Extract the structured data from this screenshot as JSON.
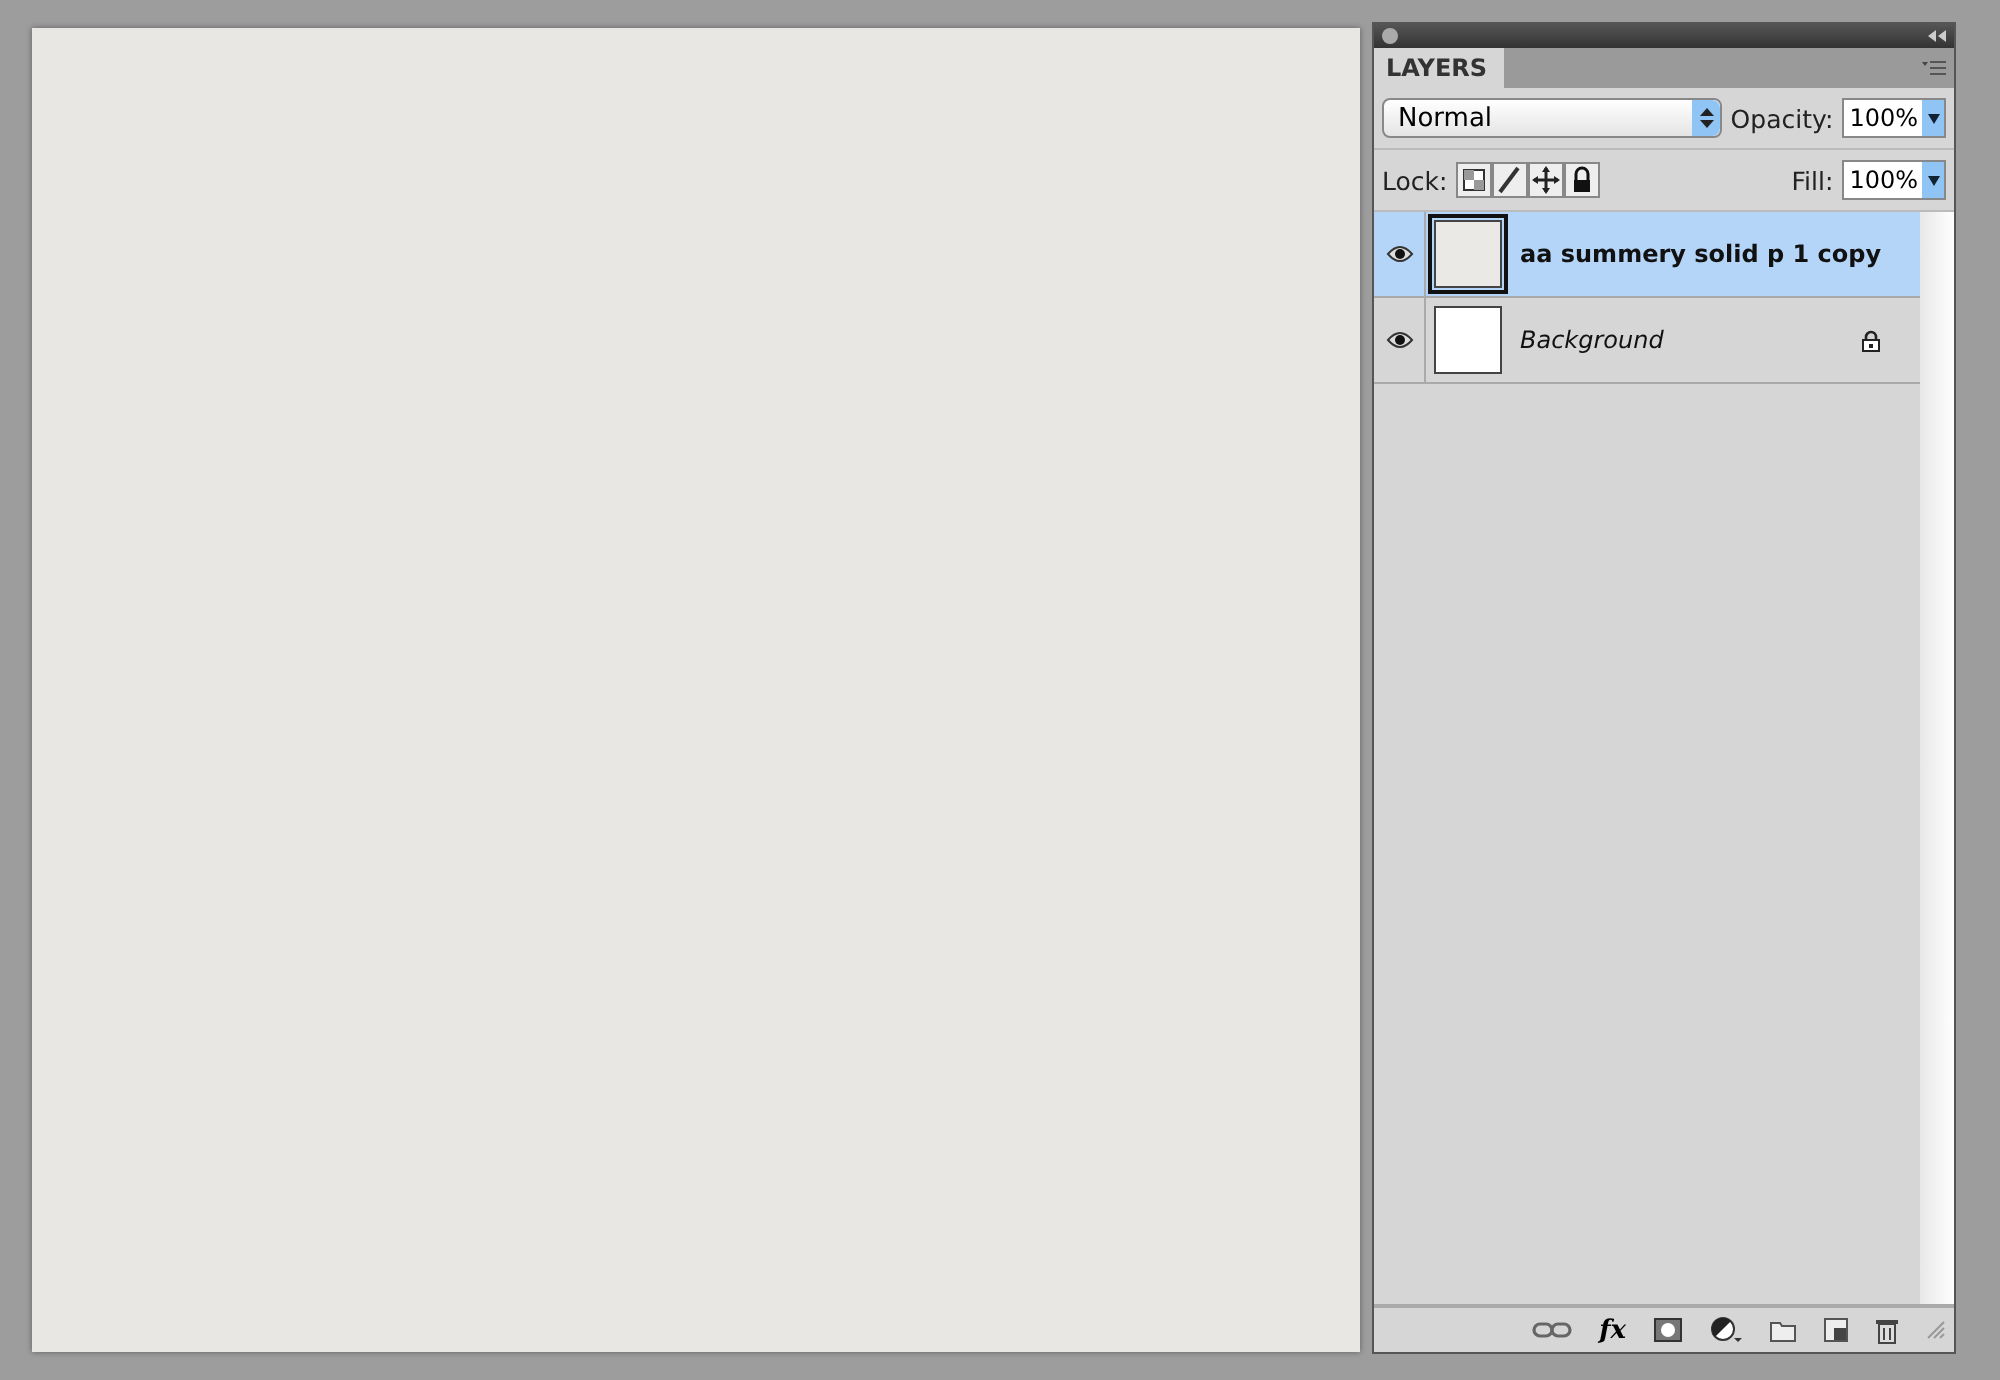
{
  "panel": {
    "tab": "LAYERS",
    "blend_mode": "Normal",
    "opacity_label": "Opacity:",
    "opacity": "100%",
    "lock_label": "Lock:",
    "fill_label": "Fill:",
    "fill": "100%"
  },
  "layers": [
    {
      "name": "aa summery solid p 1 copy",
      "kind": "layer",
      "selected": true,
      "visible": true,
      "locked": false
    },
    {
      "name": "Background",
      "kind": "background",
      "selected": false,
      "visible": true,
      "locked": true
    }
  ],
  "footer": {
    "fx": "fx"
  }
}
